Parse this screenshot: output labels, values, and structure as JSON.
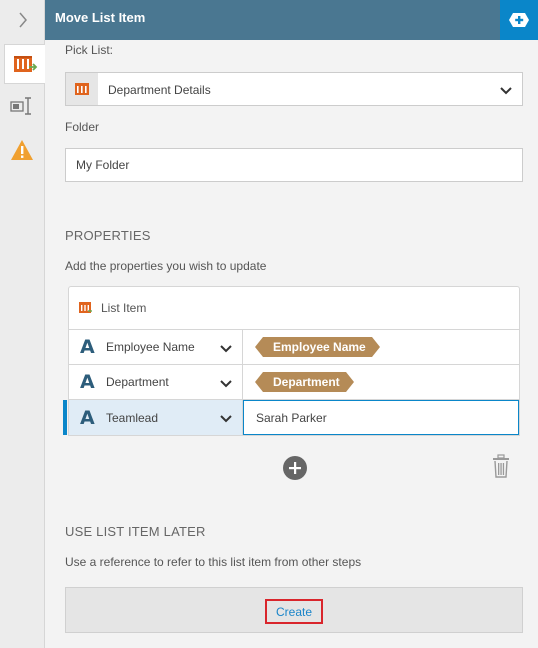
{
  "header": {
    "title": "Move List Item"
  },
  "rail": {
    "icons": [
      "chevron-right-icon",
      "list-move-icon",
      "properties-icon",
      "warning-icon"
    ]
  },
  "pick_list": {
    "label": "Pick List:",
    "value": "Department Details"
  },
  "folder": {
    "label": "Folder",
    "value": "My Folder"
  },
  "properties": {
    "title": "PROPERTIES",
    "description": "Add the properties you wish to update",
    "table_header": "List Item",
    "rows": [
      {
        "name": "Employee Name",
        "value": "Employee Name",
        "value_type": "token"
      },
      {
        "name": "Department",
        "value": "Department",
        "value_type": "token"
      },
      {
        "name": "Teamlead",
        "value": "Sarah Parker",
        "value_type": "text"
      }
    ]
  },
  "use_later": {
    "title": "USE LIST ITEM LATER",
    "description": "Use a reference to refer to this list item from other steps",
    "create_label": "Create"
  },
  "colors": {
    "header_bg": "#4a7791",
    "accent": "#0a86c9",
    "token_bg": "#b58b57",
    "warning": "#f0a030",
    "list_icon": "#e0641e",
    "highlight_border": "#d9262c"
  }
}
